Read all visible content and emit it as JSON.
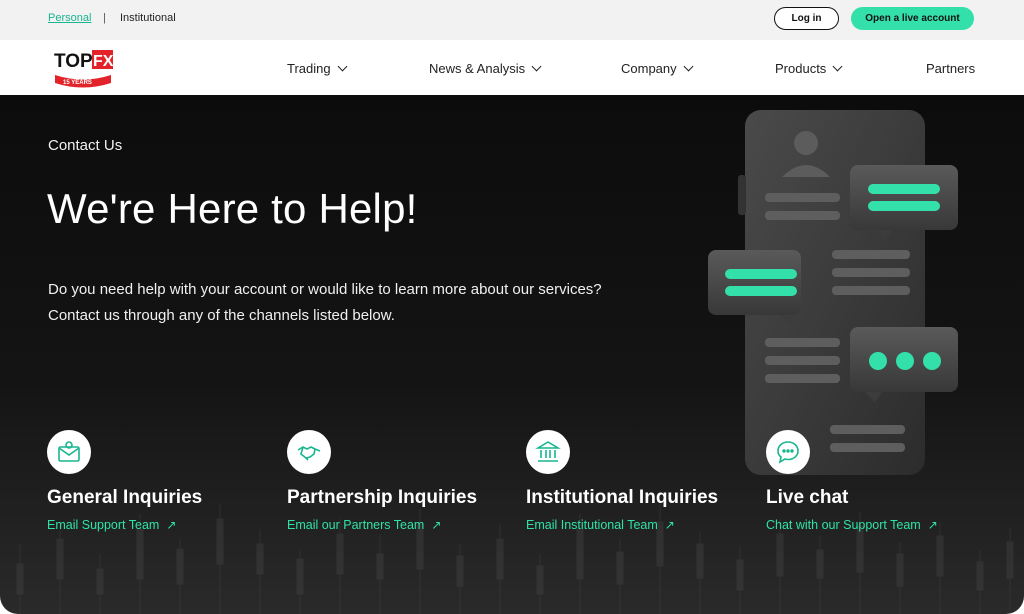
{
  "topbar": {
    "personal": "Personal",
    "separator": "|",
    "institutional": "Institutional",
    "login": "Log in",
    "open_account": "Open a live account"
  },
  "logo": {
    "text_top": "TOP",
    "text_fx": "FX",
    "badge": "15 YEARS"
  },
  "nav": {
    "trading": "Trading",
    "news": "News & Analysis",
    "company": "Company",
    "products": "Products",
    "partners": "Partners"
  },
  "hero": {
    "eyebrow": "Contact Us",
    "title": "We're Here to Help!",
    "description": "Do you need help with your account or would like to learn more about our services? Contact us through any of the channels listed below."
  },
  "cards": [
    {
      "title": "General Inquiries",
      "link": "Email Support Team",
      "icon": "envelope-icon"
    },
    {
      "title": "Partnership Inquiries",
      "link": "Email our Partners Team",
      "icon": "handshake-icon"
    },
    {
      "title": "Institutional Inquiries",
      "link": "Email Institutional Team",
      "icon": "bank-icon"
    },
    {
      "title": "Live chat",
      "link": "Chat with our Support Team",
      "icon": "chat-bubble-icon"
    }
  ],
  "colors": {
    "accent": "#34e0a9",
    "link": "#2ee3a8",
    "brand_red": "#e2232a",
    "hero_bg": "#111111"
  }
}
